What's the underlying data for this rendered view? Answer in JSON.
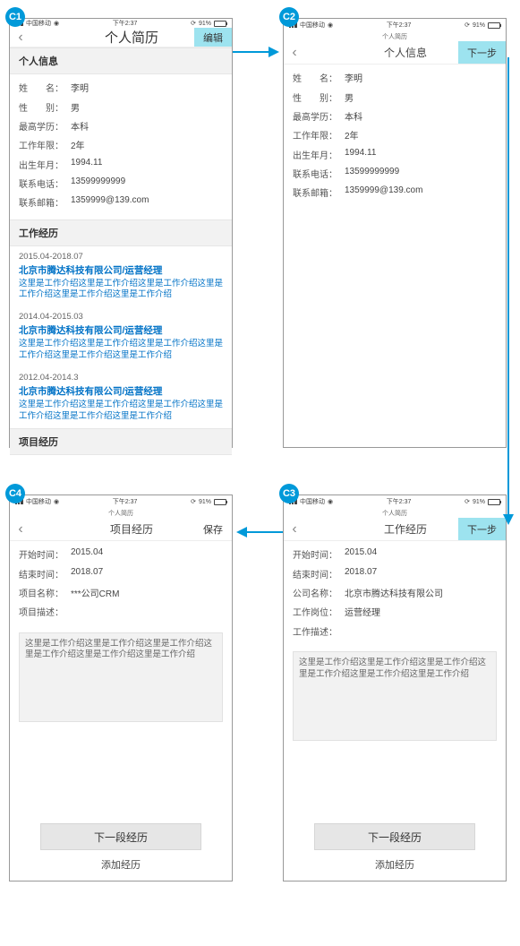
{
  "badges": {
    "c1": "C1",
    "c2": "C2",
    "c3": "C3",
    "c4": "C4"
  },
  "statusbar": {
    "carrier": "中国移动",
    "time": "下午2:37",
    "battery": "91%"
  },
  "labels": {
    "name": "姓　　名：",
    "gender": "性　　别：",
    "education": "最高学历：",
    "years": "工作年限：",
    "birth": "出生年月：",
    "phone": "联系电话：",
    "email": "联系邮箱：",
    "startTime": "开始时间：",
    "endTime": "结束时间：",
    "companyName": "公司名称：",
    "projectName": "项目名称：",
    "jobPosition": "工作岗位：",
    "jobDesc": "工作描述：",
    "projectDesc": "项目描述："
  },
  "personal": {
    "name": "李明",
    "gender": "男",
    "education": "本科",
    "years": "2年",
    "birth": "1994.11",
    "phone": "13599999999",
    "email": "1359999@139.com"
  },
  "c1": {
    "breadcrumb": "",
    "title": "个人简历",
    "action": "编辑",
    "sec_personal": "个人信息",
    "sec_work": "工作经历",
    "sec_project": "项目经历",
    "work": [
      {
        "date": "2015.04-2018.07",
        "name": "北京市腾达科技有限公司/运营经理",
        "desc": "这里是工作介绍这里是工作介绍这里是工作介绍这里是工作介绍这里是工作介绍这里是工作介绍"
      },
      {
        "date": "2014.04-2015.03",
        "name": "北京市腾达科技有限公司/运营经理",
        "desc": "这里是工作介绍这里是工作介绍这里是工作介绍这里是工作介绍这里是工作介绍这里是工作介绍"
      },
      {
        "date": "2012.04-2014.3",
        "name": "北京市腾达科技有限公司/运营经理",
        "desc": "这里是工作介绍这里是工作介绍这里是工作介绍这里是工作介绍这里是工作介绍这里是工作介绍"
      }
    ]
  },
  "c2": {
    "breadcrumb": "个人简历",
    "title": "个人信息",
    "action": "下一步"
  },
  "c3": {
    "breadcrumb": "个人简历",
    "title": "工作经历",
    "action": "下一步",
    "start": "2015.04",
    "end": "2018.07",
    "company": "北京市腾达科技有限公司",
    "position": "运营经理",
    "descText": "这里是工作介绍这里是工作介绍这里是工作介绍这里是工作介绍这里是工作介绍这里是工作介绍",
    "nextBtn": "下一段经历",
    "addLink": "添加经历"
  },
  "c4": {
    "breadcrumb": "个人简历",
    "title": "项目经历",
    "action": "保存",
    "start": "2015.04",
    "end": "2018.07",
    "project": "***公司CRM",
    "descText": "这里是工作介绍这里是工作介绍这里是工作介绍这里是工作介绍这里是工作介绍这里是工作介绍",
    "nextBtn": "下一段经历",
    "addLink": "添加经历"
  }
}
